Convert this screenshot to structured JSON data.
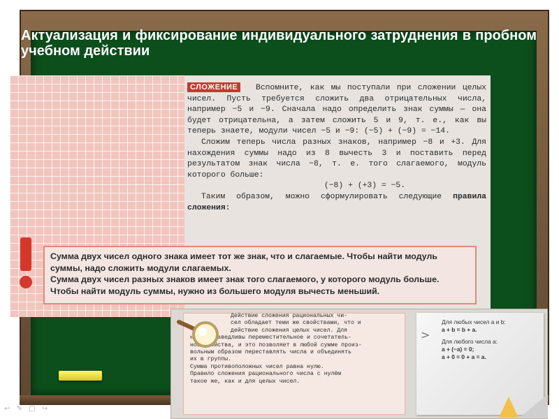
{
  "title": "Актуализация и фиксирование индивидуального затруднения в пробном учебном действии",
  "textbook": {
    "tag": "СЛОЖЕНИЕ",
    "paragraphs": [
      "Вспомните, как мы поступали при сложении целых чисел. Пусть требуется сложить два отрицательных числа, например −5 и −9. Сначала надо определить знак суммы — она будет отрицательна, а затем сложить 5 и 9, т. е., как вы теперь знаете, модули чисел −5 и −9: (−5) + (−9) = −14.",
      "Сложим теперь числа разных знаков, например −8 и +3. Для нахождения суммы надо из 8 вычесть 3 и поставить перед результатом знак числа −8, т. е. того слагаемого, модуль которого больше:"
    ],
    "formula": "(−8) + (+3) = −5.",
    "conclusion_lead": "Таким образом, можно сформулировать следующие",
    "conclusion_bold": "правила сложения:",
    "rules": [
      "Сумма двух чисел одного знака имеет тот же знак, что и слагаемые. Чтобы найти модуль суммы, надо сложить модули слагаемых.",
      "Сумма двух чисел разных знаков имеет знак того слагаемого, у которого модуль больше. Чтобы найти модуль суммы, нужно из большего модуля вычесть меньший."
    ]
  },
  "properties": {
    "lines_indented": [
      "Действие сложения рациональных чи-",
      "сел обладает теми же свойствами, что и",
      "действие сложения целых чисел. Для"
    ],
    "lines": [
      "него справедливы переместительное и сочетатель-",
      "ное свойства, и это позволяет в любой сумме произ-",
      "вольным образом переставлять числа и объединять",
      "их в группы.",
      "Сумма противоположных чисел равна нулю.",
      "Правило сложения рационального числа с нулём",
      "такое же, как и для целых чисел."
    ]
  },
  "note": {
    "line1": "Для любых чисел a и b:",
    "formula1": "a + b = b + a.",
    "line2": "Для любого числа a:",
    "formula2": "a + (−a) = 0;",
    "formula3": "a + 0 = 0 + a = a."
  },
  "colors": {
    "board": "#0d4f1c",
    "tag": "#c8372e",
    "rule_border": "#e08a7c",
    "chalk": "#fff86a"
  }
}
